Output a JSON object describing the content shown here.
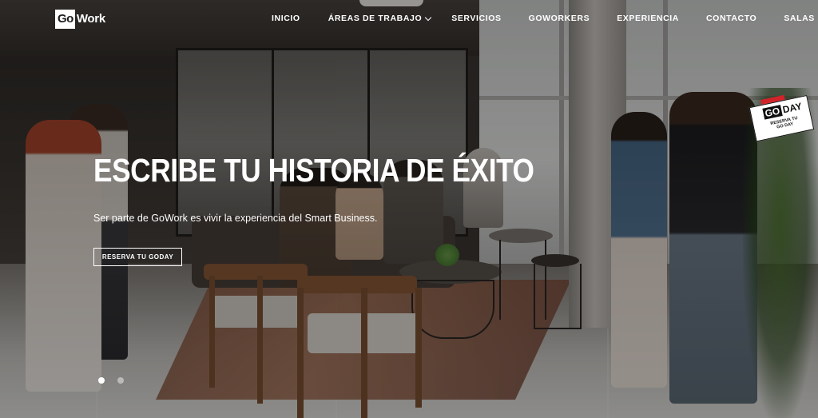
{
  "brand": {
    "logo_box": "Go",
    "logo_rest": "Work"
  },
  "nav": {
    "items": [
      {
        "label": "Inicio",
        "has_dropdown": false
      },
      {
        "label": "Áreas de trabajo",
        "has_dropdown": true
      },
      {
        "label": "Servicios",
        "has_dropdown": false
      },
      {
        "label": "Goworkers",
        "has_dropdown": false
      },
      {
        "label": "Experiencia",
        "has_dropdown": false
      },
      {
        "label": "Contacto",
        "has_dropdown": false
      },
      {
        "label": "Salas",
        "has_dropdown": false
      }
    ]
  },
  "hero": {
    "title": "ESCRIBE TU HISTORIA DE ÉXITO",
    "subtitle": "Ser parte de GoWork es vivir la experiencia del Smart Business.",
    "cta_label": "RESERVA TU GODAY"
  },
  "badge": {
    "go": "GO",
    "day": "DAY",
    "line1": "RESERVA TU",
    "line2": "GO DAY",
    "accent_color": "#d3232a"
  },
  "slider": {
    "count": 2,
    "active_index": 0
  }
}
